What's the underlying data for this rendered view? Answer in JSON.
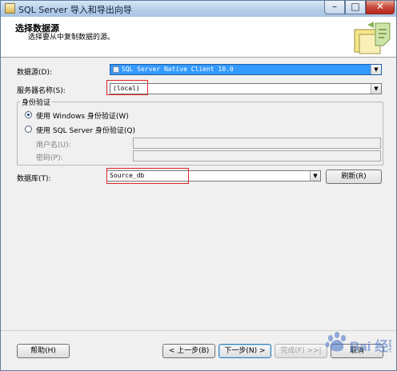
{
  "window": {
    "title": "SQL Server 导入和导出向导"
  },
  "header": {
    "title": "选择数据源",
    "subtitle": "选择要从中复制数据的源。"
  },
  "form": {
    "data_source_label": "数据源(D):",
    "data_source_value": "SQL Server Native Client 10.0",
    "server_label": "服务器名称(S):",
    "server_value": "(local)",
    "auth_group_title": "身份验证",
    "auth_windows_label": "使用 Windows 身份验证(W)",
    "auth_sql_label": "使用 SQL Server 身份验证(Q)",
    "username_label": "用户名(U):",
    "password_label": "密码(P):",
    "database_label": "数据库(T):",
    "database_value": "Source_db",
    "refresh_label": "刷新(R)"
  },
  "footer": {
    "help_label": "帮助(H)",
    "back_label": "< 上一步(B)",
    "next_label": "下一步(N) >",
    "finish_label": "完成(F) >>|",
    "cancel_label": "取消"
  },
  "watermark_text": "Bai 经验",
  "colors": {
    "selected": "#3399ff",
    "highlight": "#e0262a"
  }
}
